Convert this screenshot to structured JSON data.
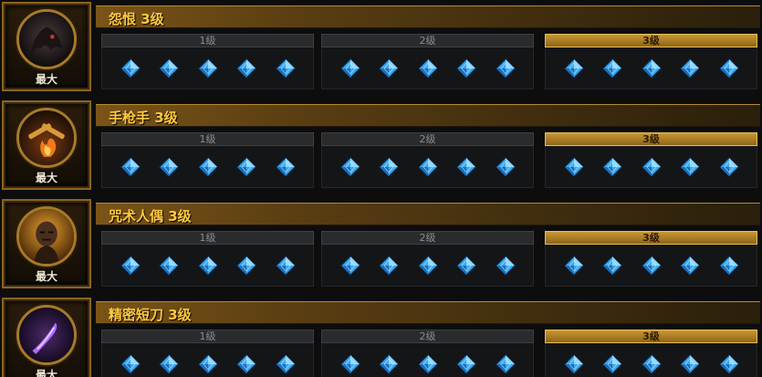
{
  "max_label": "最大",
  "tiers": [
    "1级",
    "2级",
    "3级"
  ],
  "active_tier_index": 2,
  "gems_per_tier": 5,
  "colors": {
    "title": "#ffc940",
    "gem": "#3aa8f0",
    "active_tier": "#c99834"
  },
  "skills": [
    {
      "name": "怨恨 3级",
      "portrait_icon": "shadow-beast-icon",
      "level": 3
    },
    {
      "name": "手枪手 3级",
      "portrait_icon": "crossed-pistols-icon",
      "level": 3
    },
    {
      "name": "咒术人偶 3级",
      "portrait_icon": "voodoo-doll-icon",
      "level": 3
    },
    {
      "name": "精密短刀 3级",
      "portrait_icon": "purple-blade-icon",
      "level": 3
    }
  ]
}
